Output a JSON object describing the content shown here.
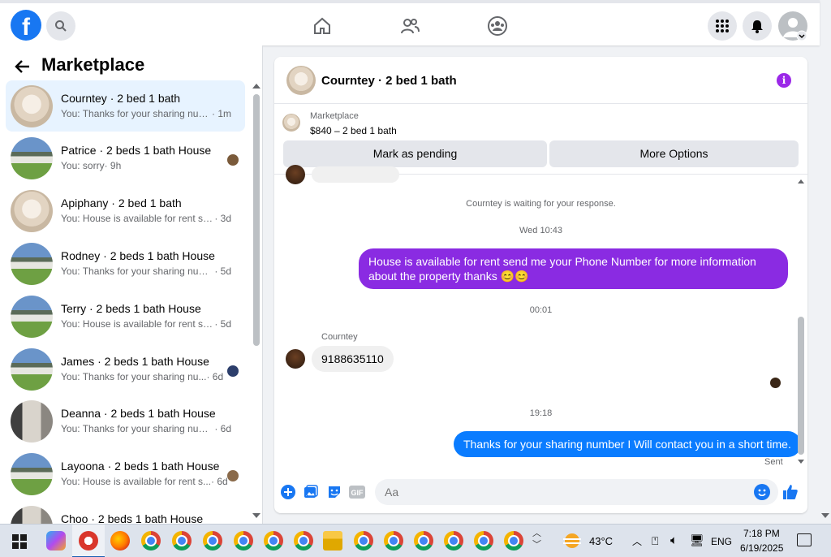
{
  "sidebar": {
    "title": "Marketplace",
    "conversations": [
      {
        "name": "Courntey · 2 bed 1 bath",
        "preview": "You: Thanks for your sharing num...",
        "time": " · 1m"
      },
      {
        "name": "Patrice · 2 beds 1 bath House",
        "preview": "You: sorry",
        "time": " · 9h"
      },
      {
        "name": "Apiphany · 2 bed 1 bath",
        "preview": "You: House is available for rent sen...",
        "time": " · 3d"
      },
      {
        "name": "Rodney · 2 beds 1 bath House",
        "preview": "You: Thanks for your sharing numb...",
        "time": " · 5d"
      },
      {
        "name": "Terry · 2 beds 1 bath House",
        "preview": "You: House is available for rent sen...",
        "time": " · 5d"
      },
      {
        "name": "James · 2 beds 1 bath House",
        "preview": "You: Thanks for your sharing nu...",
        "time": " · 6d"
      },
      {
        "name": "Deanna · 2 beds 1 bath House",
        "preview": "You: Thanks for your sharing numb...",
        "time": " · 6d"
      },
      {
        "name": "Layoona · 2 beds 1 bath House",
        "preview": "You: House is available for rent s...",
        "time": " · 6d"
      },
      {
        "name": "Choo · 2 beds 1 bath House",
        "preview": "",
        "time": ""
      }
    ]
  },
  "chat": {
    "title": "Courntey · 2 bed 1 bath",
    "listing_label": "Marketplace",
    "listing_price": "$840 – 2 bed 1 bath",
    "mark_pending": "Mark as pending",
    "more_options": "More Options",
    "waiting_notice": "Courntey is waiting for your response.",
    "time1": "Wed 10:43",
    "msg1": "House is available for rent send me your Phone Number for more information about the property thanks 😊😊",
    "time2": "00:01",
    "sender": "Courntey",
    "msg2": "9188635110",
    "time3": "19:18",
    "msg3": "Thanks for your sharing number I Will contact you in a short time.",
    "sent_status": "Sent",
    "input_placeholder": "Aa"
  },
  "taskbar": {
    "temperature": "43°C",
    "language": "ENG",
    "time": "7:18 PM",
    "date": "6/19/2025"
  },
  "colors": {
    "fb_blue": "#1877f2",
    "outgoing_purple": "#8a2be2",
    "outgoing_blue": "#0a7cff",
    "info_purple": "#9b28e8"
  }
}
